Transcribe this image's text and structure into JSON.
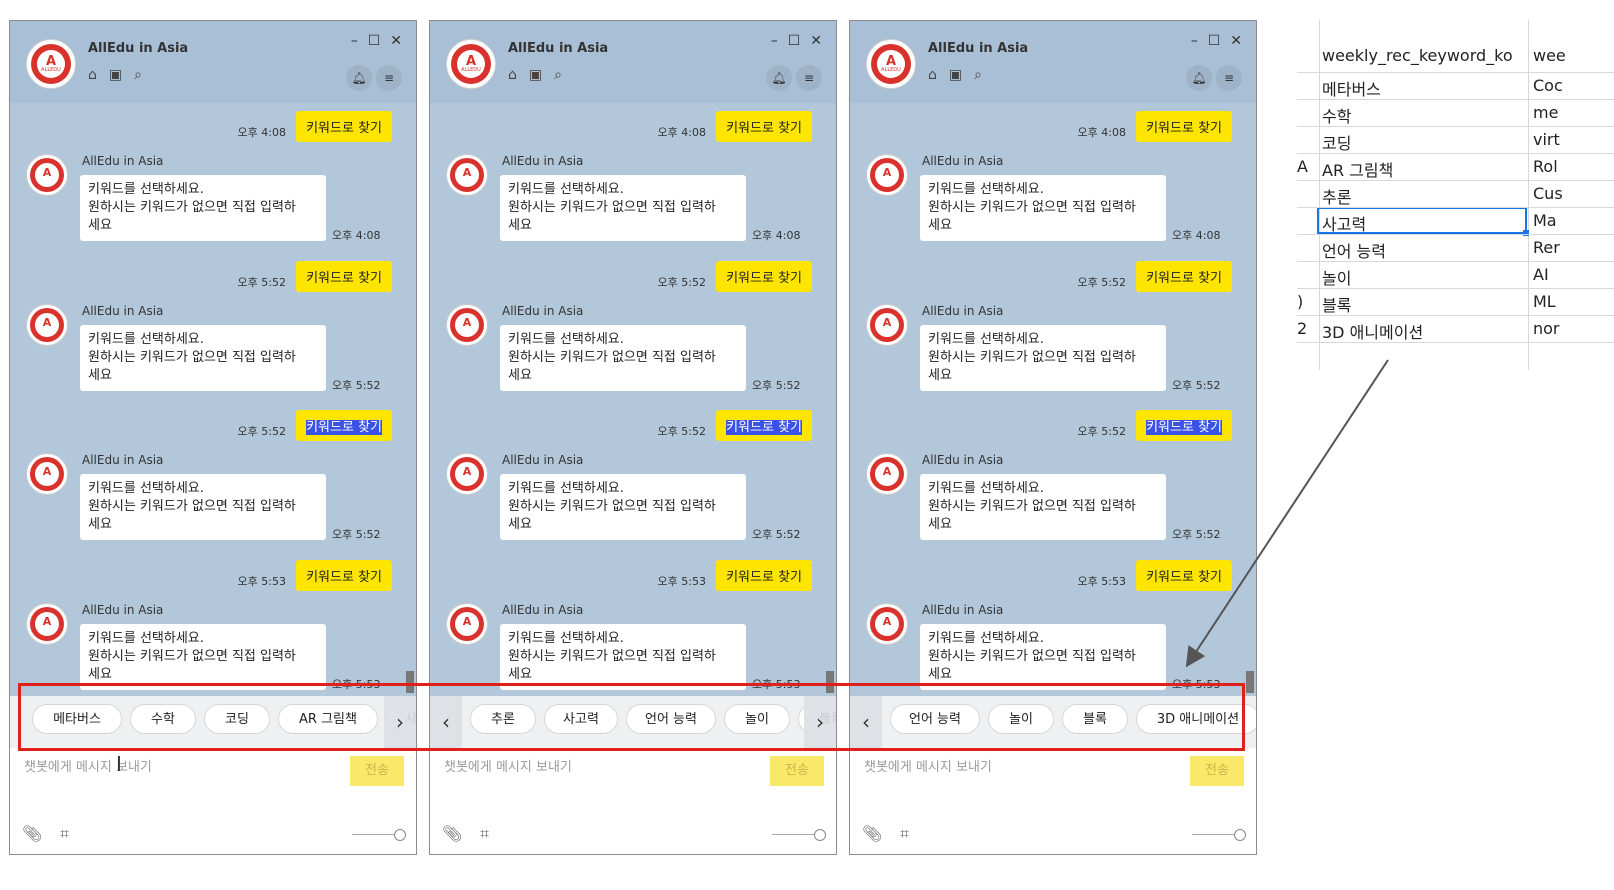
{
  "window": {
    "title": "AllEdu in Asia",
    "controls": [
      "–",
      "☐",
      "✕"
    ],
    "header_icons": [
      "home-icon",
      "inbox-icon",
      "search-icon"
    ],
    "bell_icon": "bell-icon",
    "menu_icon": "menu-icon"
  },
  "chat": {
    "user_message": "키워드로 찾기",
    "bot_name": "AllEdu in Asia",
    "bot_message": "키워드를 선택하세요.\n원하시는 키워드가 없으면 직접 입력하세요",
    "bot_message_line1": "키워드를 선택하세요.",
    "bot_message_line2": "원하시는 키워드가 없으면 직접 입력하",
    "bot_message_line3": "세요",
    "groups": [
      {
        "time_user": "오후 4:08",
        "time_bot": "오후 4:08",
        "selected": false
      },
      {
        "time_user": "오후 5:52",
        "time_bot": "오후 5:52",
        "selected": false
      },
      {
        "time_user": "오후 5:52",
        "time_bot": "오후 5:52",
        "selected": true
      },
      {
        "time_user": "오후 5:53",
        "time_bot": "오후 5:53",
        "selected": false
      }
    ]
  },
  "panels": [
    {
      "chips": [
        "메타버스",
        "수학",
        "코딩",
        "AR 그림책",
        "사고력"
      ],
      "left_arrow": false,
      "right_arrow": true
    },
    {
      "chips": [
        "추론",
        "사고력",
        "언어 능력",
        "놀이",
        "블록"
      ],
      "left_arrow": true,
      "right_arrow": true
    },
    {
      "chips": [
        "언어 능력",
        "놀이",
        "블록",
        "3D 애니메이션"
      ],
      "left_arrow": true,
      "right_arrow": false
    }
  ],
  "input": {
    "placeholder": "챗봇에게 메시지 보내기",
    "send_label": "전송"
  },
  "sheet": {
    "headers": [
      "weekly_rec_keyword_ko",
      "wee"
    ],
    "rows": [
      {
        "idx": "",
        "ko": "메타버스",
        "en": "Coc"
      },
      {
        "idx": "",
        "ko": "수학",
        "en": "me"
      },
      {
        "idx": "",
        "ko": "코딩",
        "en": "virt"
      },
      {
        "idx": "A",
        "ko": "AR 그림책",
        "en": "Rol"
      },
      {
        "idx": "",
        "ko": "추론",
        "en": "Cus"
      },
      {
        "idx": "",
        "ko": "사고력",
        "en": "Ma"
      },
      {
        "idx": "",
        "ko": "언어 능력",
        "en": "Rer"
      },
      {
        "idx": "",
        "ko": "놀이",
        "en": "AI"
      },
      {
        "idx": ")",
        "ko": "블록",
        "en": "ML"
      },
      {
        "idx": "2",
        "ko": "3D 애니메이션",
        "en": "nor"
      }
    ],
    "selected_row": 5
  },
  "colors": {
    "chat_bg": "#b2c7da",
    "user_bubble": "#fee500",
    "highlight": "#3b52e6",
    "annotation": "#e0201a",
    "arrow": "#555555"
  }
}
